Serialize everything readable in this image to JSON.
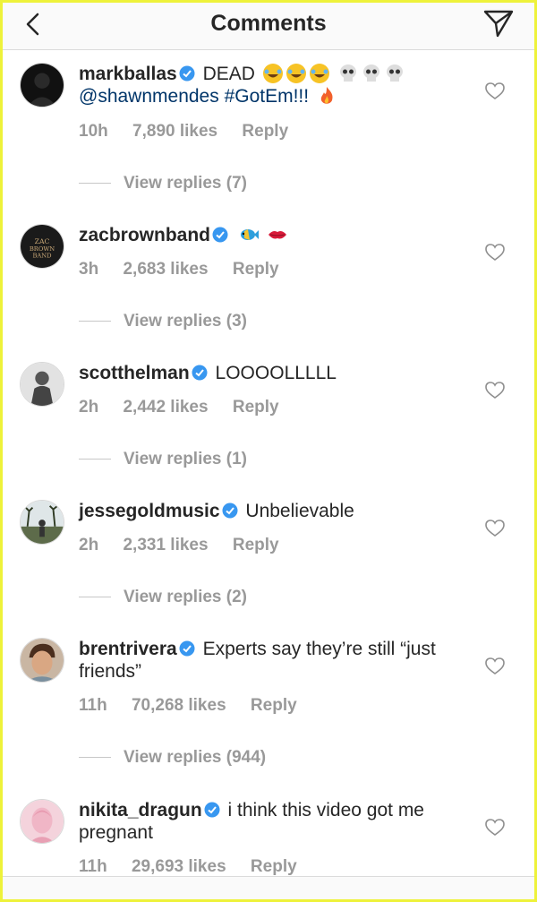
{
  "header": {
    "title": "Comments"
  },
  "comments": [
    {
      "username": "markballas",
      "text_prefix": "DEAD",
      "mention": "@shawnmendes #GotEm!!!",
      "text": "",
      "time": "10h",
      "likes": "7,890 likes",
      "reply": "Reply",
      "view_replies": "View replies (7)",
      "avatar_color": "#111111"
    },
    {
      "username": "zacbrownband",
      "text": "",
      "time": "3h",
      "likes": "2,683 likes",
      "reply": "Reply",
      "view_replies": "View replies (3)",
      "avatar_color": "#1a1a1a",
      "avatar_text": "ZAC BROWN BAND"
    },
    {
      "username": "scotthelman",
      "text": "LOOOOLLLLL",
      "time": "2h",
      "likes": "2,442 likes",
      "reply": "Reply",
      "view_replies": "View replies (1)",
      "avatar_color": "#bdbdbd"
    },
    {
      "username": "jessegoldmusic",
      "text": "Unbelievable",
      "time": "2h",
      "likes": "2,331 likes",
      "reply": "Reply",
      "view_replies": "View replies (2)",
      "avatar_color": "#6a7f6a"
    },
    {
      "username": "brentrivera",
      "text": "Experts say they’re still “just friends”",
      "time": "11h",
      "likes": "70,268 likes",
      "reply": "Reply",
      "view_replies": "View replies (944)",
      "avatar_color": "#8a6b55"
    },
    {
      "username": "nikita_dragun",
      "text": "i think this video got me pregnant",
      "time": "11h",
      "likes": "29,693 likes",
      "reply": "Reply",
      "avatar_color": "#e8b8c4"
    }
  ],
  "colors": {
    "verified": "#3897f0",
    "meta": "#999999",
    "mention": "#003569",
    "border_highlight": "#eef23a"
  },
  "icons": {
    "back": "chevron-left-icon",
    "send": "paper-plane-icon",
    "like": "heart-outline-icon",
    "verified": "verified-badge-icon"
  }
}
